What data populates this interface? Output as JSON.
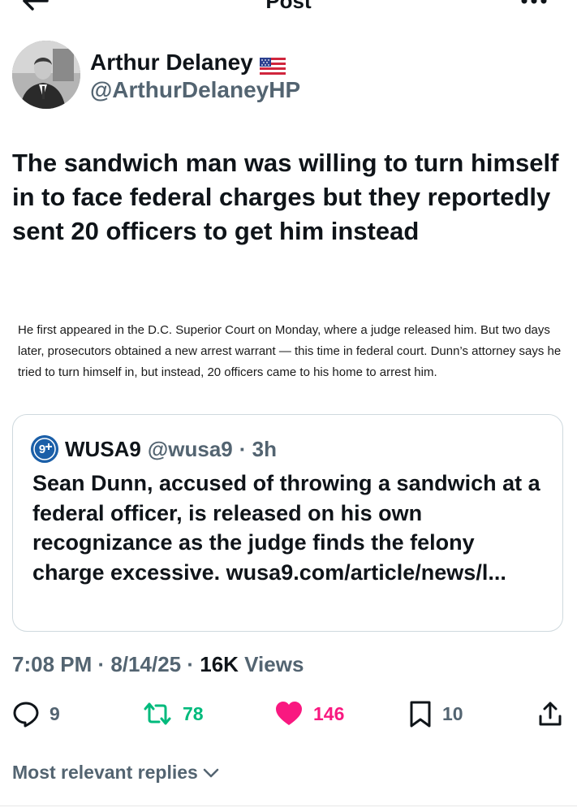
{
  "header": {
    "title": "Post"
  },
  "author": {
    "name": "Arthur Delaney",
    "handle": "@ArthurDelaneyHP"
  },
  "tweet": {
    "text": "The sandwich man was willing to turn himself in to face federal charges but they reportedly sent 20 officers to get him instead",
    "excerpt": "He first appeared in the D.C. Superior Court on Monday, where a judge released him. But two days later, prosecutors obtained a new arrest warrant — this time in federal court. Dunn’s attorney says he tried to turn himself in, but instead, 20 officers came to his home to arrest him."
  },
  "quote": {
    "name": "WUSA9",
    "handle": "@wusa9",
    "time": "· 3h",
    "avatar_text": "9",
    "text": "Sean Dunn, accused of throwing a sandwich at a federal officer, is released on his own recognizance as the judge finds the felony charge excessive. wusa9.com/article/news/l..."
  },
  "meta": {
    "time": "7:08 PM",
    "sep1": " · ",
    "date": "8/14/25",
    "sep2": " · ",
    "views_count": "16K",
    "views_label": " Views"
  },
  "actions": {
    "replies": "9",
    "reposts": "78",
    "likes": "146",
    "bookmarks": "10"
  },
  "replies_sort": {
    "label": "Most relevant replies"
  },
  "icons": {
    "back": "back-arrow-icon",
    "more": "more-dots-icon",
    "flag": "us-flag-icon",
    "reply": "reply-icon",
    "repost": "repost-icon",
    "like": "heart-icon",
    "bookmark": "bookmark-icon",
    "share": "share-icon",
    "chevron": "chevron-down-icon"
  },
  "colors": {
    "text": "#0f1419",
    "secondary": "#536471",
    "repost": "#00ba7c",
    "like": "#f91880",
    "border": "#cfd9de"
  }
}
